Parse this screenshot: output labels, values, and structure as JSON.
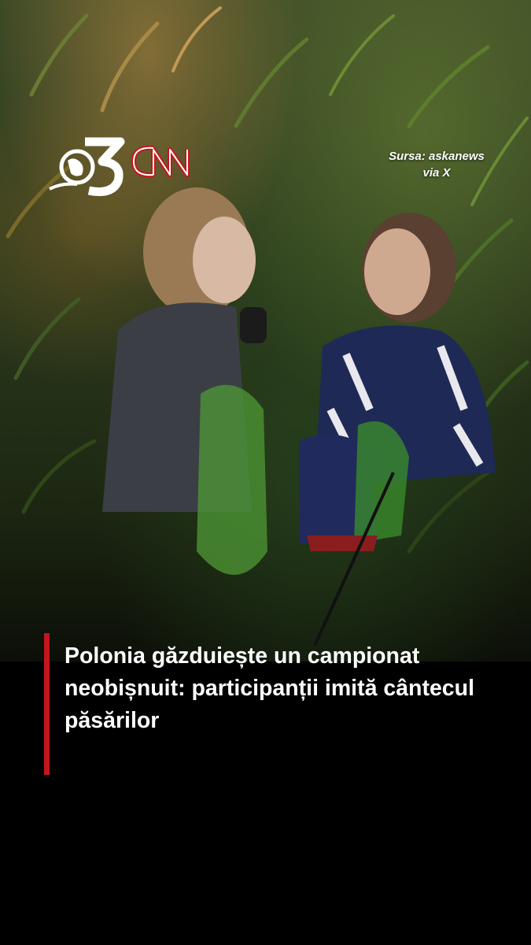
{
  "brand": {
    "logo_channel": "Antena 3",
    "logo_network": "CNN",
    "brand_red": "#c4161c"
  },
  "source": {
    "line1": "Sursa: askanews",
    "line2": "via X"
  },
  "headline": {
    "text": "Polonia găzduiește un campionat neobișnuit: participanții imită cântecul păsărilor",
    "accent_color": "#c4161c"
  }
}
